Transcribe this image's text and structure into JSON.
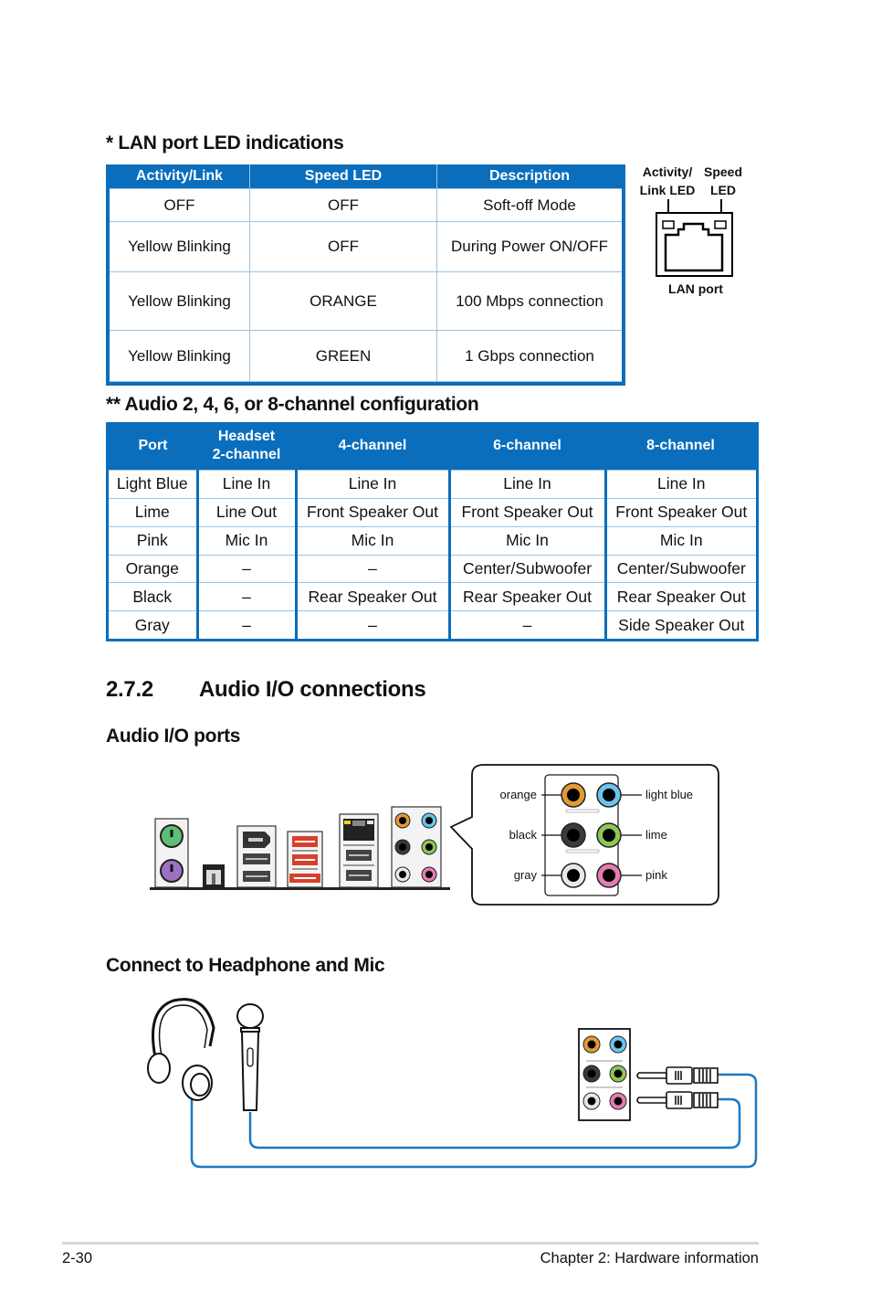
{
  "lan_section": {
    "heading": "* LAN port LED indications",
    "table": {
      "headers": [
        "Activity/Link",
        "Speed LED",
        "Description"
      ],
      "rows": [
        [
          "OFF",
          "OFF",
          "Soft-off Mode"
        ],
        [
          "Yellow Blinking",
          "OFF",
          "During Power ON/OFF"
        ],
        [
          "Yellow Blinking",
          "ORANGE",
          "100 Mbps connection"
        ],
        [
          "Yellow Blinking",
          "GREEN",
          "1 Gbps connection"
        ]
      ]
    },
    "diagram": {
      "activity_label_line1": "Activity/",
      "activity_label_line2": "Link LED",
      "speed_label_line1": "Speed",
      "speed_label_line2": "LED",
      "port_label": "LAN port"
    }
  },
  "audio_config_section": {
    "heading": "** Audio 2, 4, 6, or 8-channel configuration",
    "table": {
      "headers": [
        "Port",
        "Headset",
        "2-channel",
        "4-channel",
        "6-channel",
        "8-channel"
      ],
      "rows": [
        [
          "Light Blue",
          "Line In",
          "Line In",
          "Line In",
          "Line In"
        ],
        [
          "Lime",
          "Line Out",
          "Front Speaker Out",
          "Front Speaker Out",
          "Front Speaker Out"
        ],
        [
          "Pink",
          "Mic In",
          "Mic In",
          "Mic In",
          "Mic In"
        ],
        [
          "Orange",
          "–",
          "–",
          "Center/Subwoofer",
          "Center/Subwoofer"
        ],
        [
          "Black",
          "–",
          "Rear Speaker Out",
          "Rear Speaker Out",
          "Rear Speaker Out"
        ],
        [
          "Gray",
          "–",
          "–",
          "–",
          "Side Speaker Out"
        ]
      ]
    }
  },
  "audio_io": {
    "section_number": "2.7.2",
    "section_title": "Audio I/O connections",
    "ports_heading": "Audio I/O ports",
    "jack_labels": {
      "orange": "orange",
      "light_blue": "light blue",
      "black": "black",
      "lime": "lime",
      "gray": "gray",
      "pink": "pink"
    },
    "jack_colors": {
      "orange": "#e39a35",
      "light_blue": "#6cc4ee",
      "black": "#3a3a3a",
      "lime": "#8dc557",
      "gray": "#e8e8e8",
      "pink": "#e57cb2"
    },
    "headphone_heading": "Connect to Headphone and Mic"
  },
  "colors": {
    "table_blue": "#0a6ebd",
    "cable_blue": "#1a79c4",
    "usb_red": "#d9402b"
  },
  "footer": {
    "page_number": "2-30",
    "chapter": "Chapter 2: Hardware information"
  }
}
